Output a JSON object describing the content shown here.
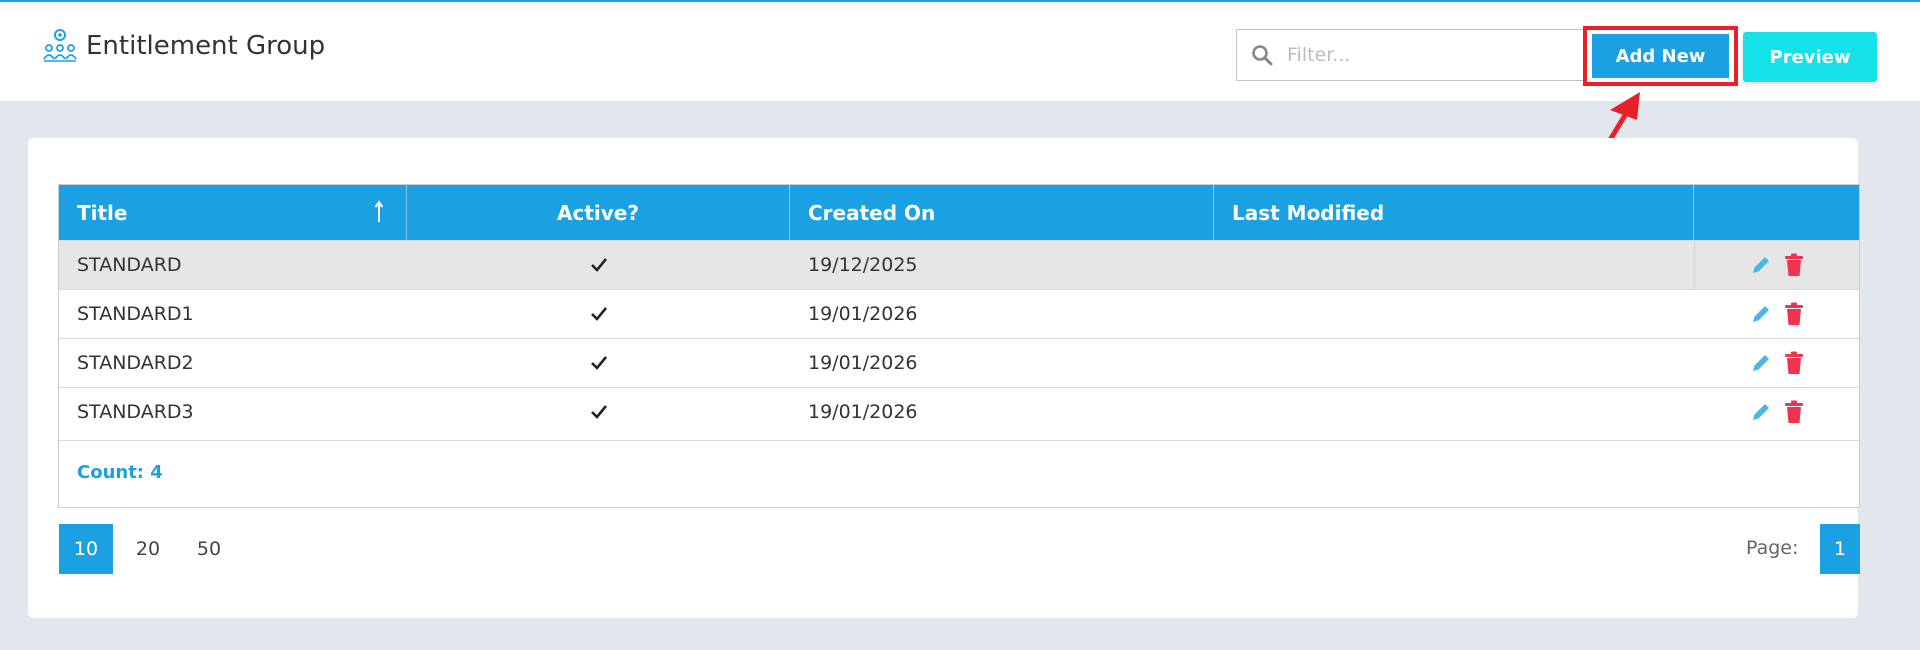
{
  "header": {
    "title": "Entitlement Group",
    "filter_placeholder": "Filter...",
    "add_new_label": "Add New",
    "preview_label": "Preview"
  },
  "grid": {
    "columns": [
      "Title",
      "Active?",
      "Created On",
      "Last Modified",
      ""
    ],
    "sort": {
      "column": "Title",
      "direction": "ascending"
    },
    "rows": [
      {
        "title": "STANDARD",
        "active": true,
        "created_on": "19/12/2025",
        "last_modified": "",
        "selected": true
      },
      {
        "title": "STANDARD1",
        "active": true,
        "created_on": "19/01/2026",
        "last_modified": "",
        "selected": false
      },
      {
        "title": "STANDARD2",
        "active": true,
        "created_on": "19/01/2026",
        "last_modified": "",
        "selected": false
      },
      {
        "title": "STANDARD3",
        "active": true,
        "created_on": "19/01/2026",
        "last_modified": "",
        "selected": false
      }
    ],
    "count_label": "Count: 4"
  },
  "pagination": {
    "page_sizes": [
      "10",
      "20",
      "50"
    ],
    "selected_page_size": "10",
    "page_label": "Page:",
    "current_page": "1"
  },
  "colors": {
    "accent": "#1ba0e1",
    "preview": "#14e2e6",
    "delete": "#f0334f",
    "edit": "#4ab6e6",
    "highlight": "#e8202a"
  },
  "icons": {
    "brand": "entitlement-group-icon",
    "filter": "search-icon",
    "sort": "sort-ascending-icon",
    "edit": "pencil-icon",
    "delete": "trash-icon",
    "active": "check-icon"
  }
}
